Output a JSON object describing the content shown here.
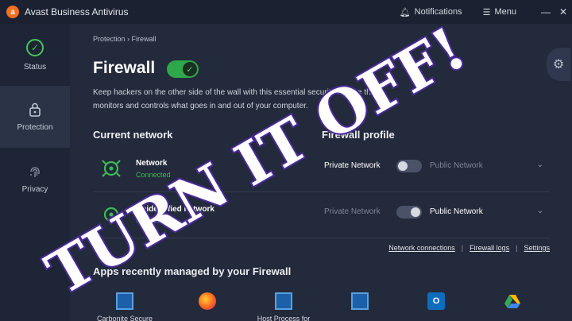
{
  "titlebar": {
    "app_title": "Avast Business Antivirus",
    "notifications_label": "Notifications",
    "menu_label": "Menu",
    "minimize_glyph": "—",
    "close_glyph": "✕"
  },
  "sidebar": {
    "items": [
      {
        "label": "Status",
        "icon": "check-circle-icon"
      },
      {
        "label": "Protection",
        "icon": "lock-icon"
      },
      {
        "label": "Privacy",
        "icon": "fingerprint-icon"
      }
    ]
  },
  "main": {
    "breadcrumb": "Protection › Firewall",
    "title": "Firewall",
    "firewall_enabled": true,
    "description": "Keep hackers on the other side of the wall with this essential security feature that monitors and controls what goes in and out of your computer.",
    "current_network_heading": "Current network",
    "firewall_profile_heading": "Firewall profile",
    "networks": [
      {
        "name": "Network",
        "status": "Connected",
        "profile_private": "Private Network",
        "profile_public": "Public Network",
        "selected": "Private Network"
      },
      {
        "name": "Unidentified network",
        "status": "Connected",
        "profile_private": "Private Network",
        "profile_public": "Public Network",
        "selected": "Public Network"
      }
    ],
    "links": [
      "Network connections",
      "Firewall logs",
      "Settings"
    ],
    "apps_heading": "Apps recently managed by your Firewall",
    "apps": [
      {
        "name": "Carbonite Secure",
        "icon": "window-app-icon"
      },
      {
        "name": "",
        "icon": "firefox-icon"
      },
      {
        "name": "Host Process for",
        "icon": "window-app-icon"
      },
      {
        "name": "",
        "icon": "window-app-icon"
      },
      {
        "name": "",
        "icon": "outlook-icon"
      },
      {
        "name": "",
        "icon": "google-drive-icon"
      }
    ]
  },
  "overlay": {
    "text": "TURN IT OFF!"
  },
  "colors": {
    "accent_green": "#2ea84a",
    "background": "#232a3b",
    "sidebar": "#1e2536",
    "overlay_text": "#ffffff",
    "overlay_outline": "#4a2a9a"
  }
}
